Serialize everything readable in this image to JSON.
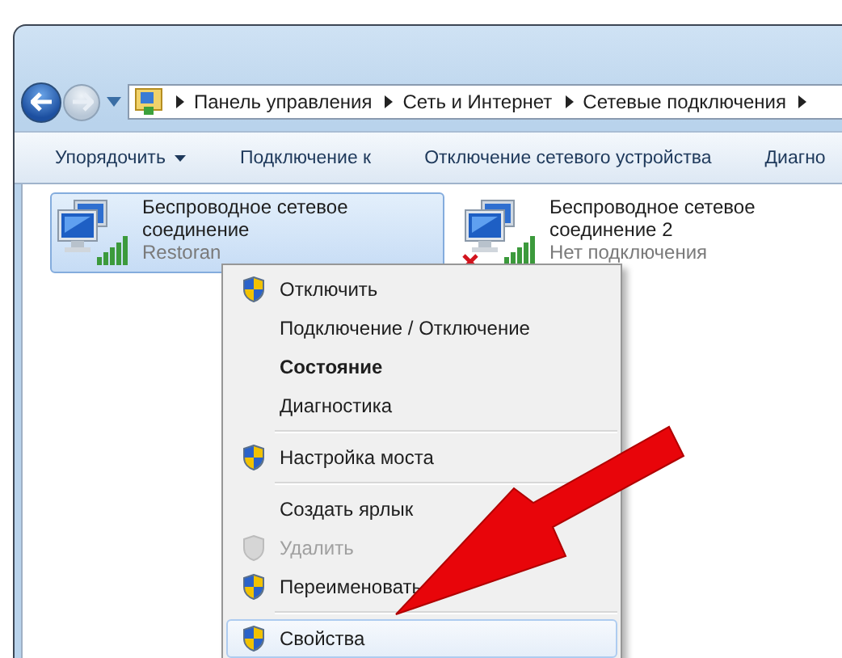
{
  "address_bar": {
    "breadcrumbs": [
      "Панель управления",
      "Сеть и Интернет",
      "Сетевые подключения"
    ]
  },
  "toolbar": [
    {
      "label": "Упорядочить",
      "dropdown": true
    },
    {
      "label": "Подключение к",
      "dropdown": false
    },
    {
      "label": "Отключение сетевого устройства",
      "dropdown": false
    },
    {
      "label": "Диагно",
      "dropdown": false
    }
  ],
  "connections": [
    {
      "name": "Беспроводное сетевое соединение",
      "status": "Restoran",
      "selected": true,
      "connected": true
    },
    {
      "name": "Беспроводное сетевое соединение 2",
      "status": "Нет подключения",
      "selected": false,
      "connected": false
    }
  ],
  "context_menu": {
    "groups": [
      {
        "items": [
          {
            "label": "Отключить",
            "shield": true,
            "bold": false,
            "disabled": false,
            "selected": false
          },
          {
            "label": "Подключение / Отключение",
            "shield": false,
            "bold": false,
            "disabled": false,
            "selected": false
          },
          {
            "label": "Состояние",
            "shield": false,
            "bold": true,
            "disabled": false,
            "selected": false
          },
          {
            "label": "Диагностика",
            "shield": false,
            "bold": false,
            "disabled": false,
            "selected": false
          }
        ]
      },
      {
        "items": [
          {
            "label": "Настройка моста",
            "shield": true,
            "bold": false,
            "disabled": false,
            "selected": false
          }
        ]
      },
      {
        "items": [
          {
            "label": "Создать ярлык",
            "shield": false,
            "bold": false,
            "disabled": false,
            "selected": false
          },
          {
            "label": "Удалить",
            "shield": true,
            "bold": false,
            "disabled": true,
            "selected": false
          },
          {
            "label": "Переименовать",
            "shield": true,
            "bold": false,
            "disabled": false,
            "selected": false
          }
        ]
      },
      {
        "items": [
          {
            "label": "Свойства",
            "shield": true,
            "bold": false,
            "disabled": false,
            "selected": true
          }
        ]
      }
    ]
  }
}
